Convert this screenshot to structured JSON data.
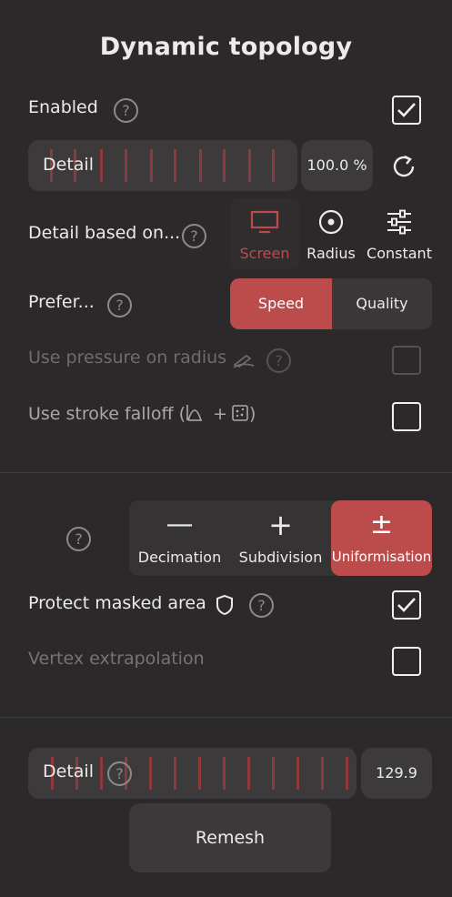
{
  "title": "Dynamic topology",
  "enabled": {
    "label": "Enabled",
    "checked": true
  },
  "detail_slider": {
    "label": "Detail",
    "value": "100.0 %"
  },
  "detail_based_on": {
    "label": "Detail based on...",
    "options": [
      {
        "label": "Screen",
        "icon": "monitor-icon",
        "selected": true
      },
      {
        "label": "Radius",
        "icon": "target-icon",
        "selected": false
      },
      {
        "label": "Constant",
        "icon": "sliders-icon",
        "selected": false
      }
    ]
  },
  "prefer": {
    "label": "Prefer...",
    "options": [
      {
        "label": "Speed",
        "selected": true
      },
      {
        "label": "Quality",
        "selected": false
      }
    ]
  },
  "use_pressure": {
    "label": "Use pressure on radius",
    "checked": false,
    "disabled": true
  },
  "use_stroke_falloff": {
    "label": "Use stroke falloff (",
    "plus": "+",
    "close": ")",
    "checked": false
  },
  "mode": {
    "options": [
      {
        "label": "Decimation",
        "symbol": "—",
        "selected": false
      },
      {
        "label": "Subdivision",
        "symbol": "+",
        "selected": false
      },
      {
        "label": "Uniformisation",
        "symbol": "±",
        "selected": true
      }
    ]
  },
  "protect_masked": {
    "label": "Protect masked area",
    "checked": true
  },
  "vertex_extrapolation": {
    "label": "Vertex extrapolation",
    "checked": false,
    "disabled": true
  },
  "remesh_detail": {
    "label": "Detail",
    "value": "129.9"
  },
  "remesh_button": {
    "label": "Remesh"
  },
  "help_glyph": "?",
  "colors": {
    "accent": "#bc4b4c",
    "tick": "#8e3a3c",
    "background": "#2b292a"
  }
}
